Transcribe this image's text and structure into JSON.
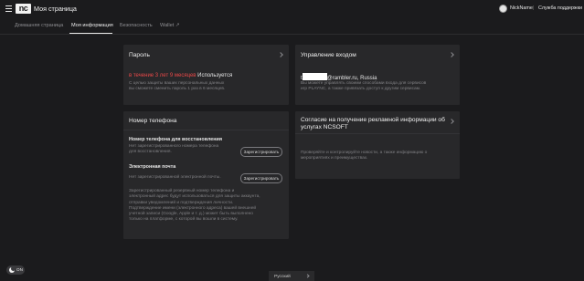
{
  "header": {
    "logo": "nc",
    "app_title": "Моя страница",
    "nickname": "NickName",
    "separator": "|",
    "support": "Служба поддержки"
  },
  "tabs": [
    {
      "label": "Домашняя страница",
      "active": false
    },
    {
      "label": "Моя информация",
      "active": true
    },
    {
      "label": "Безопасность",
      "active": false
    },
    {
      "label": "Wallet ↗",
      "active": false
    }
  ],
  "password_card": {
    "title": "Пароль",
    "status_red": "в течение 3 лет 9 месяцев",
    "status_rest": "Используется",
    "desc_lines": [
      "С целью защиты ваших персональных данных",
      "вы сможете сменить пароль 1 раз в 6 месяцев."
    ]
  },
  "login_card": {
    "title": "Управление входом",
    "email_prefix": "t",
    "email_suffix": "@rambler.ru, Russia",
    "desc_lines": [
      "Вы можете управлять своими способами входа для сервисов",
      "игр PLAYNC, а также привязать доступ к другим сервисам."
    ]
  },
  "phone_card": {
    "title": "Номер телефона",
    "recovery_heading": "Номер телефона для восстановления",
    "recovery_lines": [
      "Нет зарегистрированного номера телефона",
      "для восстановления."
    ],
    "recovery_button": "Зарегистрировать",
    "email_heading": "Электронная почта",
    "email_line": "Нет зарегистрированной электронной почты.",
    "email_button": "Зарегистрировать",
    "note_lines": [
      "Зарегистрированный резервный номер телефона и",
      "электронный адрес будут использоваться для защиты аккаунта,",
      "отправки уведомлений и подтверждения личности.",
      "Подтверждение имени (электронного адреса) вашей внешней",
      "учетной записи (Google, Apple и т. д.) может быть выполнено",
      "только на платформе, с которой вы вошли в систему."
    ]
  },
  "consent_card": {
    "title_lines": [
      "Согласие на получение рекламной информации об",
      "услугах NCSOFT"
    ],
    "desc_lines": [
      "Проверяйте и контролируйте новости, а также информацию о",
      "мероприятиях и преимуществах."
    ]
  },
  "footer": {
    "theme_toggle": "ON",
    "language": "Русский"
  },
  "icons": {
    "menu": "hamburger-icon",
    "chevron": "chevron-right-icon",
    "theme": "moon-icon"
  },
  "colors": {
    "background": "#1b1b1d",
    "card": "#28282a",
    "accent_red": "#e84848"
  }
}
